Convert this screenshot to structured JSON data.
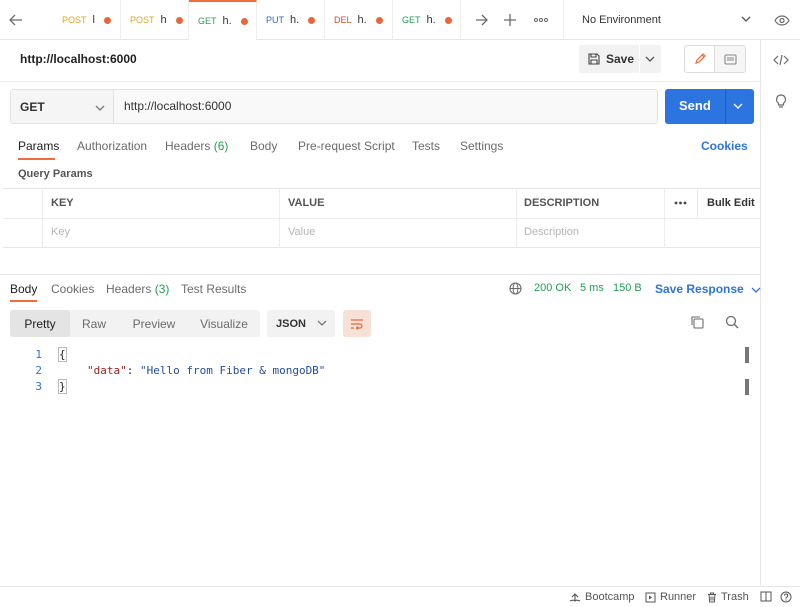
{
  "tabs": [
    {
      "method": "POST",
      "name": "l",
      "method_color": "#e0a421"
    },
    {
      "method": "POST",
      "name": "h",
      "method_color": "#e0a421"
    },
    {
      "method": "GET",
      "name": "h.",
      "method_color": "#239e55",
      "active": true
    },
    {
      "method": "PUT",
      "name": "h.",
      "method_color": "#2b6bd1"
    },
    {
      "method": "DEL",
      "name": "h.",
      "method_color": "#d8432e"
    },
    {
      "method": "GET",
      "name": "h.",
      "method_color": "#239e55"
    }
  ],
  "environment": {
    "label": "No Environment"
  },
  "request": {
    "title": "http://localhost:6000",
    "method": "GET",
    "url": "http://localhost:6000",
    "save_label": "Save",
    "send_label": "Send"
  },
  "request_tabs": [
    {
      "label": "Params",
      "count": ""
    },
    {
      "label": "Authorization",
      "count": ""
    },
    {
      "label": "Headers",
      "count": "(6)"
    },
    {
      "label": "Body",
      "count": ""
    },
    {
      "label": "Pre-request Script",
      "count": ""
    },
    {
      "label": "Tests",
      "count": ""
    },
    {
      "label": "Settings",
      "count": ""
    }
  ],
  "cookies_link": "Cookies",
  "query_params": {
    "heading": "Query Params",
    "columns": [
      "KEY",
      "VALUE",
      "DESCRIPTION"
    ],
    "bulk_edit": "Bulk Edit",
    "placeholders": [
      "Key",
      "Value",
      "Description"
    ]
  },
  "response_tabs": [
    {
      "label": "Body",
      "count": ""
    },
    {
      "label": "Cookies",
      "count": ""
    },
    {
      "label": "Headers",
      "count": "(3)"
    },
    {
      "label": "Test Results",
      "count": ""
    }
  ],
  "response_meta": {
    "status": "200 OK",
    "time": "5 ms",
    "size": "150 B",
    "save_label": "Save Response"
  },
  "view_modes": [
    "Pretty",
    "Raw",
    "Preview",
    "Visualize"
  ],
  "format": "JSON",
  "code_lines": [
    {
      "n": "1",
      "text": "{"
    },
    {
      "n": "2",
      "key": "\"data\"",
      "sep": ": ",
      "value": "\"Hello from Fiber & mongoDB\""
    },
    {
      "n": "3",
      "text": "}"
    }
  ],
  "status_bar": {
    "bootcamp": "Bootcamp",
    "runner": "Runner",
    "trash": "Trash"
  },
  "colors": {
    "accent": "#f26b3a",
    "primary": "#2c74e0",
    "success": "#239e55"
  }
}
